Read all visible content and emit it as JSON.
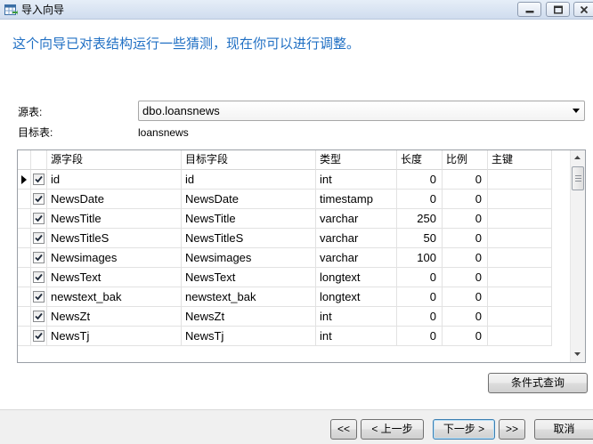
{
  "window": {
    "title": "导入向导",
    "icon": "table-import-icon",
    "controls": [
      "minimize-icon",
      "maximize-icon",
      "close-icon"
    ]
  },
  "instruction": "这个向导已对表结构运行一些猜测，现在你可以进行调整。",
  "source_table": {
    "label": "源表:",
    "value": "dbo.loansnews"
  },
  "target_table": {
    "label": "目标表:",
    "value": "loansnews"
  },
  "grid": {
    "columns": {
      "source_field": "源字段",
      "target_field": "目标字段",
      "type": "类型",
      "length": "长度",
      "scale": "比例",
      "primary_key": "主键"
    },
    "current_row": 0,
    "vertical_scroll_position": 0,
    "rows": [
      {
        "checked": true,
        "source_field": "id",
        "target_field": "id",
        "type": "int",
        "length": 0,
        "scale": 0,
        "primary_key": false
      },
      {
        "checked": true,
        "source_field": "NewsDate",
        "target_field": "NewsDate",
        "type": "timestamp",
        "length": 0,
        "scale": 0,
        "primary_key": false
      },
      {
        "checked": true,
        "source_field": "NewsTitle",
        "target_field": "NewsTitle",
        "type": "varchar",
        "length": 250,
        "scale": 0,
        "primary_key": false
      },
      {
        "checked": true,
        "source_field": "NewsTitleS",
        "target_field": "NewsTitleS",
        "type": "varchar",
        "length": 50,
        "scale": 0,
        "primary_key": false
      },
      {
        "checked": true,
        "source_field": "Newsimages",
        "target_field": "Newsimages",
        "type": "varchar",
        "length": 100,
        "scale": 0,
        "primary_key": false
      },
      {
        "checked": true,
        "source_field": "NewsText",
        "target_field": "NewsText",
        "type": "longtext",
        "length": 0,
        "scale": 0,
        "primary_key": false
      },
      {
        "checked": true,
        "source_field": "newstext_bak",
        "target_field": "newstext_bak",
        "type": "longtext",
        "length": 0,
        "scale": 0,
        "primary_key": false
      },
      {
        "checked": true,
        "source_field": "NewsZt",
        "target_field": "NewsZt",
        "type": "int",
        "length": 0,
        "scale": 0,
        "primary_key": false
      },
      {
        "checked": true,
        "source_field": "NewsTj",
        "target_field": "NewsTj",
        "type": "int",
        "length": 0,
        "scale": 0,
        "primary_key": false
      }
    ]
  },
  "buttons": {
    "condition_query": "条件式查询",
    "first": "<<",
    "back": "< 上一步",
    "next": "下一步 >",
    "last": ">>",
    "cancel": "取消"
  },
  "theme": {
    "instruction_color": "#2170c4",
    "focus_color": "#3c7fb1"
  }
}
